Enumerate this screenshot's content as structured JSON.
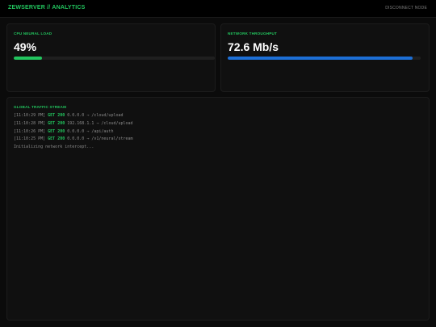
{
  "colors": {
    "accent_green": "#22c55e",
    "accent_blue": "#1d6fd6",
    "text_muted": "#7c7c7c"
  },
  "header": {
    "title": "ZEWSERVER // ANALYTICS",
    "disconnect_label": "DISCONNECT NODE"
  },
  "cpu": {
    "title": "CPU NEURAL LOAD",
    "value": "49%",
    "progress_percent": 14
  },
  "network": {
    "title": "NETWORK THROUGHPUT",
    "value": "72.6 Mb/s",
    "progress_percent": 96
  },
  "traffic": {
    "title": "GLOBAL TRAFFIC STREAM",
    "logs": [
      {
        "time": "[11:10:29 PM]",
        "method": "GET",
        "status": "200",
        "ip": "0.0.0.0",
        "path": "→ /cloud/upload"
      },
      {
        "time": "[11:10:28 PM]",
        "method": "GET",
        "status": "200",
        "ip": "192.168.1.1",
        "path": "→ /cloud/upload"
      },
      {
        "time": "[11:10:26 PM]",
        "method": "GET",
        "status": "200",
        "ip": "0.0.0.0",
        "path": "→ /api/auth"
      },
      {
        "time": "[11:10:25 PM]",
        "method": "GET",
        "status": "200",
        "ip": "0.0.0.0",
        "path": "→ /v1/neural/stream"
      }
    ],
    "init_message": "Initializing network intercept..."
  }
}
